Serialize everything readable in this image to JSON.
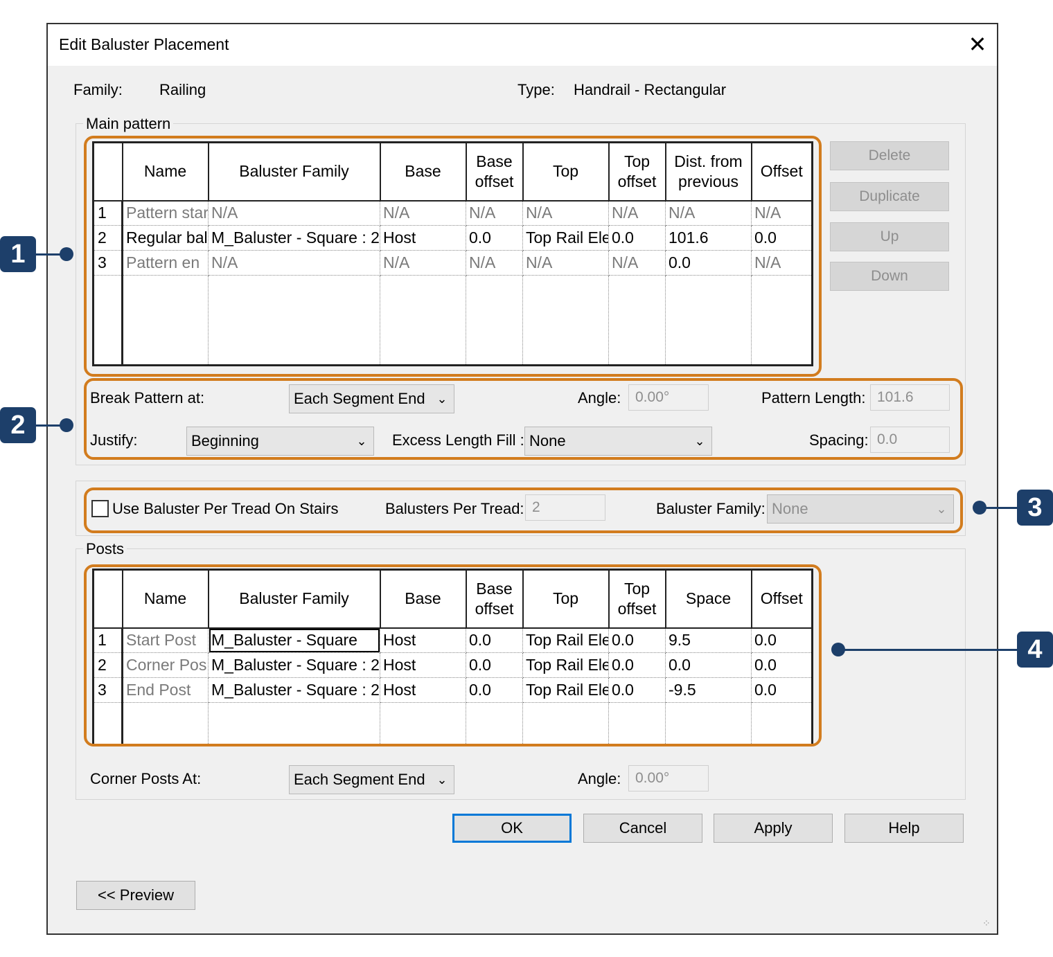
{
  "dialog": {
    "title": "Edit Baluster Placement",
    "close_glyph": "✕",
    "family_label": "Family:",
    "family_value": "Railing",
    "type_label": "Type:",
    "type_value": "Handrail - Rectangular"
  },
  "main_pattern": {
    "group_label": "Main pattern",
    "headers": [
      "",
      "Name",
      "Baluster Family",
      "Base",
      "Base offset",
      "Top",
      "Top offset",
      "Dist. from previous",
      "Offset"
    ],
    "rows": [
      [
        "1",
        "Pattern star",
        "N/A",
        "N/A",
        "N/A",
        "N/A",
        "N/A",
        "N/A",
        "N/A"
      ],
      [
        "2",
        "Regular bal",
        "M_Baluster - Square : 2",
        "Host",
        "0.0",
        "Top Rail Ele",
        "0.0",
        "101.6",
        "0.0"
      ],
      [
        "3",
        "Pattern en",
        "N/A",
        "N/A",
        "N/A",
        "N/A",
        "N/A",
        "0.0",
        "N/A"
      ]
    ],
    "buttons": {
      "delete": "Delete",
      "duplicate": "Duplicate",
      "up": "Up",
      "down": "Down"
    },
    "break_pattern_label": "Break Pattern at:",
    "break_pattern_value": "Each Segment End",
    "angle_label": "Angle:",
    "angle_value": "0.00°",
    "pattern_length_label": "Pattern Length:",
    "pattern_length_value": "101.6",
    "justify_label": "Justify:",
    "justify_value": "Beginning",
    "excess_fill_label": "Excess Length Fill :",
    "excess_fill_value": "None",
    "spacing_label": "Spacing:",
    "spacing_value": "0.0"
  },
  "tread": {
    "checkbox_label": "Use Baluster Per Tread On Stairs",
    "checked": false,
    "per_tread_label": "Balusters Per Tread:",
    "per_tread_value": "2",
    "family_label": "Baluster Family:",
    "family_value": "None"
  },
  "posts": {
    "group_label": "Posts",
    "headers": [
      "",
      "Name",
      "Baluster Family",
      "Base",
      "Base offset",
      "Top",
      "Top offset",
      "Space",
      "Offset"
    ],
    "rows": [
      [
        "1",
        "Start Post",
        "M_Baluster - Square",
        "Host",
        "0.0",
        "Top Rail Ele",
        "0.0",
        "9.5",
        "0.0"
      ],
      [
        "2",
        "Corner Pos",
        "M_Baluster - Square : 2",
        "Host",
        "0.0",
        "Top Rail Ele",
        "0.0",
        "0.0",
        "0.0"
      ],
      [
        "3",
        "End Post",
        "M_Baluster - Square : 2",
        "Host",
        "0.0",
        "Top Rail Ele",
        "0.0",
        "-9.5",
        "0.0"
      ]
    ],
    "corner_posts_label": "Corner Posts At:",
    "corner_posts_value": "Each Segment End",
    "angle_label": "Angle:",
    "angle_value": "0.00°"
  },
  "footer": {
    "ok": "OK",
    "cancel": "Cancel",
    "apply": "Apply",
    "help": "Help",
    "preview": "<< Preview"
  },
  "callouts": [
    "1",
    "2",
    "3",
    "4"
  ],
  "colors": {
    "callout_border": "#d27c1e",
    "badge": "#1d3f6a",
    "default_button_border": "#0078d7"
  }
}
